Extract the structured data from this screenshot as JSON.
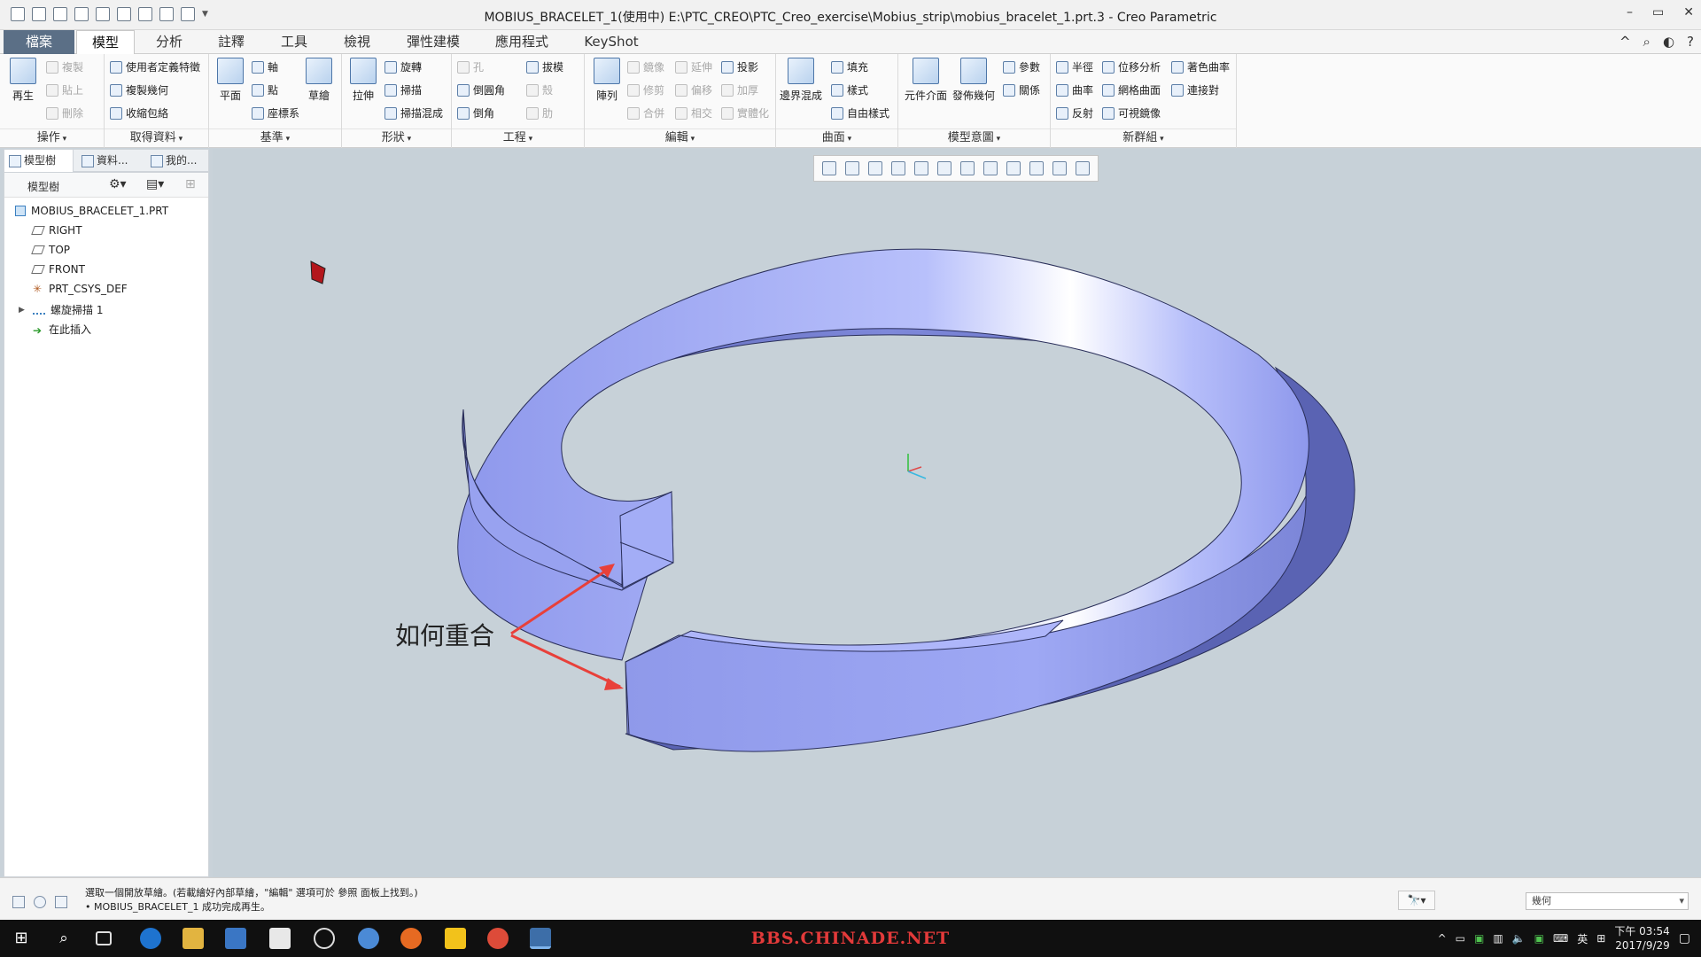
{
  "window": {
    "title": "MOBIUS_BRACELET_1(使用中) E:\\PTC_CREO\\PTC_Creo_exercise\\Mobius_strip\\mobius_bracelet_1.prt.3 - Creo Parametric",
    "controls": [
      "–",
      "▭",
      "✕"
    ]
  },
  "menu": {
    "tabs": [
      "檔案",
      "模型",
      "分析",
      "註釋",
      "工具",
      "檢視",
      "彈性建模",
      "應用程式",
      "KeyShot"
    ],
    "active": "模型",
    "right_icons": [
      "^",
      "⌕",
      "◐",
      "?"
    ]
  },
  "ribbon": {
    "operations": {
      "label": "操作",
      "regen": "再生",
      "copy": "複製",
      "paste": "貼上",
      "delete": "刪除"
    },
    "get_data": {
      "label": "取得資料",
      "udf": "使用者定義特徵",
      "copy_geom": "複製幾何",
      "shrinkwrap": "收縮包絡"
    },
    "datum": {
      "label": "基準",
      "plane": "平面",
      "axis": "軸",
      "point": "點",
      "csys": "座標系",
      "sketch": "草繪"
    },
    "shapes": {
      "label": "形狀",
      "extrude": "拉伸",
      "revolve": "旋轉",
      "sweep": "掃描",
      "swept_blend": "掃描混成"
    },
    "engineering": {
      "label": "工程",
      "hole": "孔",
      "round": "倒圓角",
      "chamfer": "倒角",
      "draft": "拔模",
      "shell": "殼",
      "rib": "肋"
    },
    "editing": {
      "label": "編輯",
      "pattern": "陣列",
      "mirror": "鏡像",
      "trim": "修剪",
      "merge": "合併",
      "extend": "延伸",
      "offset": "偏移",
      "intersect": "相交",
      "project": "投影",
      "thicken": "加厚",
      "solidify": "實體化"
    },
    "surfaces": {
      "label": "曲面",
      "boundary_blend": "邊界混成",
      "fill": "填充",
      "style": "樣式",
      "freestyle": "自由樣式"
    },
    "model_intent": {
      "label": "模型意圖",
      "component_interface": "元件介面",
      "publish_geom": "發佈幾何",
      "parameters": "參數",
      "relations": "關係"
    },
    "new_group": {
      "label": "新群組",
      "radius": "半徑",
      "curvature": "曲率",
      "reflection": "反射",
      "offset_analysis": "位移分析",
      "mesh_surface": "網格曲面",
      "visible_mirror": "可視鏡像",
      "shaded_curvature": "著色曲率",
      "connect": "連接對"
    }
  },
  "left_panel": {
    "tabs": [
      "模型樹",
      "資料...",
      "我的..."
    ],
    "tree_header": "模型樹",
    "items": [
      "MOBIUS_BRACELET_1.PRT",
      "RIGHT",
      "TOP",
      "FRONT",
      "PRT_CSYS_DEF",
      "螺旋掃描 1",
      "在此插入"
    ]
  },
  "annotation": {
    "text": "如何重合",
    "arrow_color": "#e8403a"
  },
  "model": {
    "face_color": "#9aa4f2",
    "highlight_color": "#ffffff",
    "shadow_color": "#5d66b8"
  },
  "status": {
    "line1": "選取一個開放草繪。(若載繪好內部草繪，\"編輯\" 選項可於 參照 面板上找到。)",
    "line2": "• MOBIUS_BRACELET_1 成功完成再生。",
    "filter": "幾何"
  },
  "taskbar": {
    "watermark": "BBS.CHINADE.NET",
    "ime": "英",
    "time": "下午 03:54",
    "date": "2017/9/29"
  }
}
